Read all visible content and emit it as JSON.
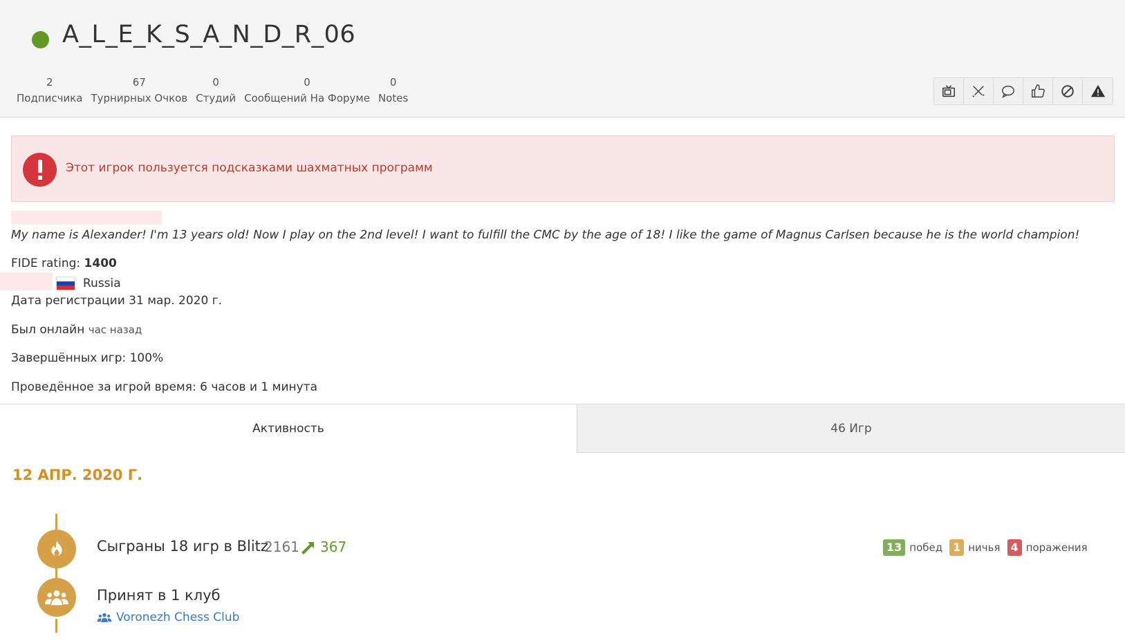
{
  "profile": {
    "username": "A_L_E_K_S_A_N_D_R_06",
    "online_color": "#629924"
  },
  "stats": [
    {
      "num": "2",
      "label": "Подписчика"
    },
    {
      "num": "67",
      "label": "Турнирных Очков"
    },
    {
      "num": "0",
      "label": "Студий"
    },
    {
      "num": "0",
      "label": "Сообщений На Форуме"
    },
    {
      "num": "0",
      "label": "Notes"
    }
  ],
  "actions": [
    "tv-icon",
    "swords-icon",
    "message-icon",
    "thumbs-up-icon",
    "block-icon",
    "warning-icon"
  ],
  "alert": {
    "text": "Этот игрок пользуется подсказками шахматных программ",
    "color": "#c0392b"
  },
  "bio": "My name is Alexander! I'm 13 years old! Now I play on the 2nd level! I want to fulfill the CMC by the age of 18! I like the game of Magnus Carlsen because he is the world champion!",
  "fide": {
    "label": "FIDE rating: ",
    "value": "1400"
  },
  "country": "Russia",
  "registered": "Дата регистрации 31 мар. 2020 г.",
  "last_online": {
    "label": "Был онлайн ",
    "value": "час назад"
  },
  "completed_games": "Завершённых игр: 100%",
  "time_played": "Проведённое за игрой время: 6 часов и 1 минута",
  "tabs": [
    {
      "label": "Активность",
      "active": true
    },
    {
      "label": "46 Игр",
      "active": false
    }
  ],
  "activity": {
    "date": "12 АПР. 2020 Г.",
    "entries": [
      {
        "title": "Сыграны 18 игр в Blitz",
        "rating": "2161",
        "diff": "367",
        "wins": {
          "count": "13",
          "label": "побед",
          "color": "#629924"
        },
        "draws": {
          "count": "1",
          "label": "ничья",
          "color": "#d59020"
        },
        "losses": {
          "count": "4",
          "label": "поражения",
          "color": "#cc3333"
        }
      },
      {
        "title": "Принят в 1 клуб",
        "club": "Voronezh Chess Club"
      }
    ]
  },
  "colors": {
    "accent": "#d59020",
    "timeline": "#d5a047",
    "link": "#3a7ac4"
  }
}
